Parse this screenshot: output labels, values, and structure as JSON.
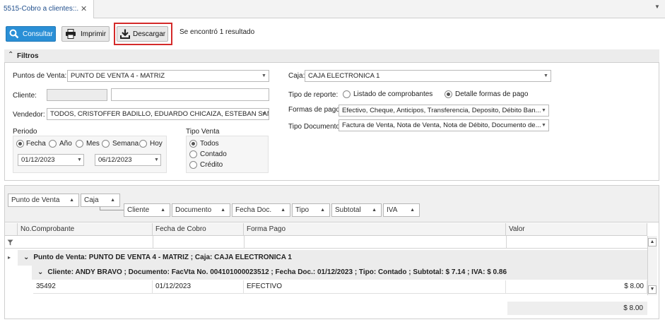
{
  "tab": {
    "title": "5515-Cobro a clientes::.",
    "close": "✕",
    "menu": "▼"
  },
  "toolbar": {
    "consultar": "Consultar",
    "imprimir": "Imprimir",
    "descargar": "Descargar",
    "result_text": "Se encontró 1 resultado",
    "accent_color": "#2a8fd6",
    "highlight_color": "#d42a2a"
  },
  "filters": {
    "title": "Filtros",
    "punto_venta_label": "Puntos de Venta:",
    "punto_venta_value": "PUNTO DE VENTA 4 - MATRIZ",
    "cliente_label": "Cliente:",
    "cliente_value": "",
    "vendedor_label": "Vendedor:",
    "vendedor_value": "TODOS, CRISTOFFER BADILLO, EDUARDO CHICAIZA, ESTEBAN SAN ...",
    "periodo_label": "Periodo",
    "periodo_options": [
      "Fecha",
      "Año",
      "Mes",
      "Semana",
      "Hoy"
    ],
    "periodo_selected": "Fecha",
    "fecha_desde": "01/12/2023",
    "fecha_hasta": "06/12/2023",
    "tipo_venta_label": "Tipo Venta",
    "tipo_venta_options": [
      "Todos",
      "Contado",
      "Crédito"
    ],
    "tipo_venta_selected": "Todos",
    "caja_label": "Caja:",
    "caja_value": "CAJA ELECTRONICA 1",
    "tipo_reporte_label": "Tipo de reporte:",
    "tipo_reporte_options": [
      "Listado de comprobantes",
      "Detalle formas de pago"
    ],
    "tipo_reporte_selected": "Detalle formas de pago",
    "formas_pago_label": "Formas de pago",
    "formas_pago_value": "Efectivo, Cheque, Anticipos, Transferencia, Deposito, Débito Ban...",
    "tipo_documento_label": "Tipo Documento",
    "tipo_documento_value": "Factura de Venta, Nota de Venta, Nota de Débito, Documento de..."
  },
  "grid": {
    "group_chips": [
      "Punto de Venta",
      "Caja",
      "Cliente",
      "Documento",
      "Fecha Doc.",
      "Tipo",
      "Subtotal",
      "IVA"
    ],
    "columns": [
      "No.Comprobante",
      "Fecha de Cobro",
      "Forma Pago",
      "Valor"
    ],
    "group1": "Punto de Venta: PUNTO DE VENTA 4 - MATRIZ ; Caja: CAJA ELECTRONICA 1",
    "group2": "Cliente: ANDY BRAVO ; Documento: FacVta No. 004101000023512 ; Fecha Doc.: 01/12/2023 ; Tipo: Contado ; Subtotal: $ 7.14 ; IVA: $ 0.86",
    "rows": [
      {
        "comprobante": "35492",
        "fecha": "01/12/2023",
        "forma": "EFECTIVO",
        "valor": "$ 8.00"
      }
    ],
    "total": "$ 8.00"
  }
}
